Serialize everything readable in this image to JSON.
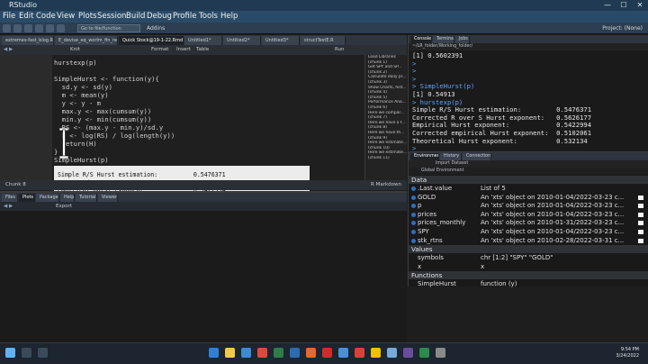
{
  "window": {
    "title": "RStudio",
    "controls": [
      "—",
      "☐",
      "✕"
    ]
  },
  "menu": [
    "File",
    "Edit",
    "Code",
    "View",
    "Plots",
    "Session",
    "Build",
    "Debug",
    "Profile",
    "Tools",
    "Help"
  ],
  "toolbar": {
    "goto_placeholder": "Go to file/function",
    "addins": "Addins",
    "project": "Project: (None)"
  },
  "source_tabs": [
    "extremes-fast_blog.R",
    "E_devise_eq_worlm_fin_new_draft_wo...",
    "Quick Stock@19-1-22.Rmd",
    "Untitled1*",
    "Untitled2*",
    "Untitled3*",
    "structTestE.R"
  ],
  "editor_toolbar": {
    "knit": "Knit",
    "format": "Format",
    "insert": "Insert",
    "table": "Table",
    "run": "Run"
  },
  "code_lines": [
    "hurstexp(p)",
    "",
    "SimpleHurst <- function(y){",
    "  sd.y <- sd(y)",
    "  m <- mean(y)",
    "  y <- y - m",
    "  max.y <- max(cumsum(y))",
    "  min.y <- min(cumsum(y))",
    "  RS <- (max.y - min.y)/sd.y",
    "  H <- log(RS) / log(length(y))",
    "  return(H)",
    "}",
    "SimpleHurst(p)"
  ],
  "chunk_output": [
    "Simple R/S Hurst estimation:          0.5476371",
    "Corrected R over S Hurst exponent:    0.5626177",
    "Empirical Hurst exponent:             0.5422994",
    "Corrected empirical Hurst exponent:   0.5102061",
    "Theoretical Hurst exponent:           0.532134"
  ],
  "outline": [
    "Load Libraries",
    "(chunk 1)",
    "Get SPY and SP...",
    "(chunk 2)",
    "Calculate daily pr...",
    "(chunk 3)",
    "Show Charts, hist...",
    "(chunk 4)",
    "(chunk 5)",
    "Performance Ana...",
    "(chunk 6)",
    "Here we compar...",
    "(chunk 7)",
    "Here we have a f...",
    "(chunk 8)",
    "Here we have th...",
    "(chunk 9)",
    "Here we estimate...",
    "(chunk 10)",
    "Here we estimate...",
    "(chunk 11)"
  ],
  "editor_status": {
    "position": "Chunk 8",
    "mode": "R Markdown"
  },
  "files_tabs": [
    "Files",
    "Plots",
    "Packages",
    "Help",
    "Tutorial",
    "Viewer"
  ],
  "files_tools": {
    "export": "Export"
  },
  "console_tabs": [
    "Console",
    "Terminal",
    "Jobs"
  ],
  "console_path": "~/LR_folder/Working_folder/",
  "console_lines": [
    {
      "t": "[1] 0.5602391",
      "p": false
    },
    {
      "t": ">",
      "p": true
    },
    {
      "t": ">",
      "p": true
    },
    {
      "t": ">",
      "p": true
    },
    {
      "t": "> SimpleHurst(p)",
      "p": true
    },
    {
      "t": "[1] 0.54913",
      "p": false
    },
    {
      "t": "> hurstexp(p)",
      "p": true
    },
    {
      "t": "Simple R/S Hurst estimation:         0.5476371",
      "p": false
    },
    {
      "t": "Corrected R over S Hurst exponent:   0.5626177",
      "p": false
    },
    {
      "t": "Empirical Hurst exponent:            0.5422994",
      "p": false
    },
    {
      "t": "Corrected empirical Hurst exponent:  0.5102061",
      "p": false
    },
    {
      "t": "Theoretical Hurst exponent:          0.532134",
      "p": false
    },
    {
      "t": ">",
      "p": true
    }
  ],
  "env_tabs": [
    "Environment",
    "History",
    "Connections"
  ],
  "env_tools": {
    "import": "Import Dataset",
    "scope": "Global Environment"
  },
  "env_sections": {
    "data": "Data",
    "values": "Values",
    "functions": "Functions"
  },
  "env_data": [
    {
      "name": ".Last.value",
      "value": "List of 5"
    },
    {
      "name": "GOLD",
      "value": "An 'xts' object on 2010-01-04/2022-03-23 c..."
    },
    {
      "name": "p",
      "value": "An 'xts' object on 2010-01-04/2022-03-23 c..."
    },
    {
      "name": "prices",
      "value": "An 'xts' object on 2010-01-04/2022-03-23 c..."
    },
    {
      "name": "prices_monthly",
      "value": "An 'xts' object on 2010-01-31/2022-03-23 c..."
    },
    {
      "name": "SPY",
      "value": "An 'xts' object on 2010-01-04/2022-03-23 c..."
    },
    {
      "name": "stk_rtns",
      "value": "An 'xts' object on 2010-02-28/2022-03-31 c..."
    }
  ],
  "env_values": [
    {
      "name": "symbols",
      "value": "chr [1:2] \"SPY\" \"GOLD\""
    },
    {
      "name": "x",
      "value": "x"
    }
  ],
  "env_functions": [
    {
      "name": "SimpleHurst",
      "value": "function (y)"
    }
  ],
  "taskbar": {
    "time": "9:54 PM",
    "date": "3/24/2022"
  }
}
